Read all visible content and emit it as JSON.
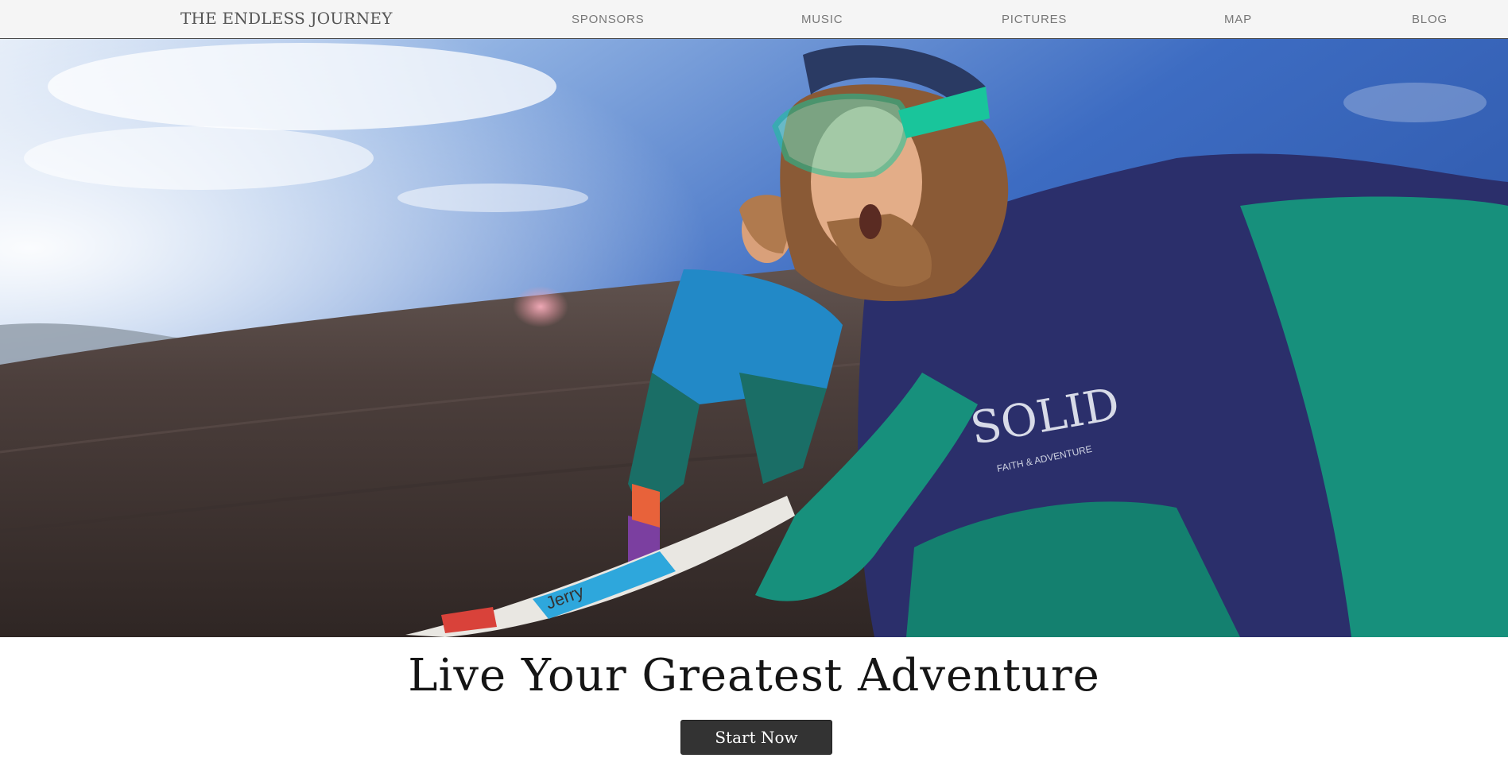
{
  "navbar": {
    "brand": "THE ENDLESS JOURNEY",
    "items": [
      {
        "label": "SPONSORS"
      },
      {
        "label": "MUSIC"
      },
      {
        "label": "PICTURES"
      },
      {
        "label": "MAP"
      },
      {
        "label": "BLOG"
      }
    ]
  },
  "hero": {
    "image": "sandboarding-selfie-photo",
    "shirt_text": "SOLID",
    "shirt_subtext": "FAITH & ADVENTURE",
    "board_text": "Jerry"
  },
  "main": {
    "headline": "Live Your Greatest Adventure",
    "cta_label": "Start Now"
  },
  "colors": {
    "nav_bg": "#f5f5f5",
    "button_bg": "#333333",
    "sky": "#3f6fc4",
    "slope": "#4a3d3a",
    "jacket": "#17907c"
  }
}
